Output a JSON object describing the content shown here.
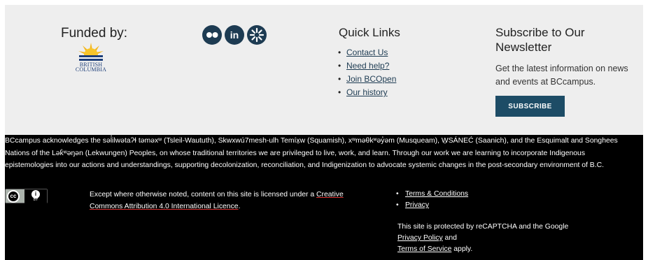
{
  "funded": {
    "title": "Funded by:",
    "logo_line1": "BRITISH",
    "logo_line2": "COLUMBIA"
  },
  "social": {
    "icons": [
      "flickr-icon",
      "linkedin-icon",
      "asterisk-icon"
    ],
    "linkedin_glyph": "in"
  },
  "quick_links": {
    "title": "Quick Links",
    "items": [
      "Contact Us",
      "Need help?",
      "Join BCOpen",
      "Our history"
    ]
  },
  "newsletter": {
    "title": "Subscribe to Our Newsletter",
    "description": "Get the latest information on news and events at BCcampus.",
    "button": "SUBSCRIBE"
  },
  "acknowledgement": "BCcampus acknowledges the səl̓ilwətaʔɬ təməxʷ (Tsleil-Waututh), Skwxwú7mesh-ulh Temíx̱w (Squamish), xʷməθkʷəy̓əm (Musqueam), W̱SÁNEĆ (Saanich), and the Esquimalt and Songhees Nations of the Lək̓ʷəŋən (Lekwungen) Peoples, on whose traditional territories we are privileged to live, work, and learn. Through our work we are learning to incorporate Indigenous epistemologies into our actions and understandings, supporting decolonization, reconciliation, and Indigenization to advocate systemic changes in the post-secondary environment of B.C.",
  "license": {
    "badge_cc": "cc",
    "badge_by": "BY",
    "text_before": "Except where otherwise noted, content on this site is licensed under a ",
    "link": "Creative Commons Attribution 4.0 International Licence",
    "text_after": "."
  },
  "legal": {
    "items": [
      "Terms & Conditions",
      "Privacy"
    ]
  },
  "recaptcha": {
    "text": "This site is protected by reCAPTCHA and the Google ",
    "privacy_link": "Privacy Policy",
    "and": " and",
    "terms_link": "Terms of Service",
    "apply": " apply."
  },
  "colors": {
    "top_bg": "#eeeeee",
    "bottom_bg": "#000000",
    "accent": "#1d4c66",
    "link": "#1d3b52"
  }
}
